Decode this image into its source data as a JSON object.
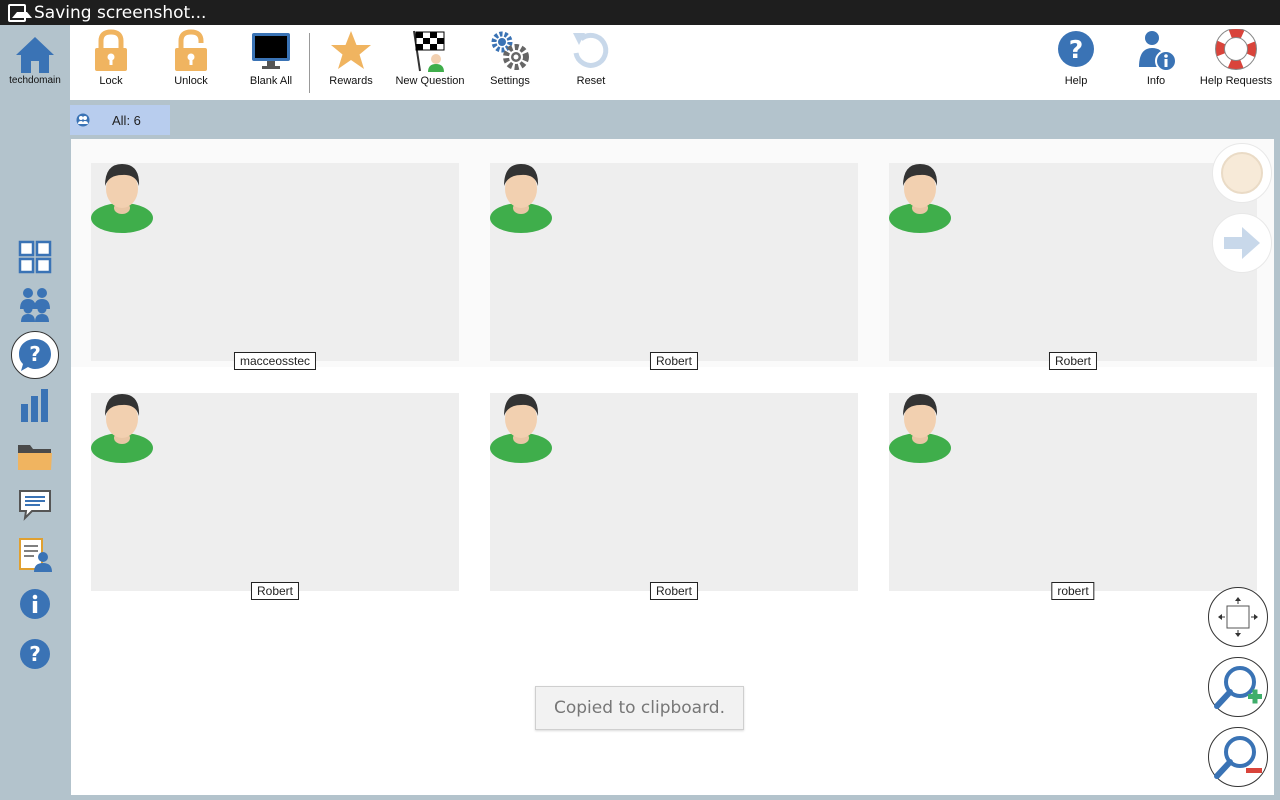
{
  "status_bar": {
    "text": "Saving screenshot..."
  },
  "sidebar": {
    "home_label": "techdomain",
    "items": [
      {
        "icon": "grid-view-icon"
      },
      {
        "icon": "groups-icon"
      },
      {
        "icon": "question-bubble-icon",
        "active": true
      },
      {
        "icon": "bar-chart-icon"
      },
      {
        "icon": "folder-icon"
      },
      {
        "icon": "chat-icon"
      },
      {
        "icon": "student-report-icon"
      },
      {
        "icon": "info-icon"
      },
      {
        "icon": "help-icon"
      }
    ]
  },
  "toolbar": {
    "lock": "Lock",
    "unlock": "Unlock",
    "blank_all": "Blank All",
    "rewards": "Rewards",
    "new_question": "New Question",
    "settings": "Settings",
    "reset": "Reset",
    "help": "Help",
    "info": "Info",
    "help_requests": "Help Requests"
  },
  "tabs": {
    "all_label": "All: 6"
  },
  "students": [
    {
      "name": "macceosstec"
    },
    {
      "name": "Robert"
    },
    {
      "name": "Robert"
    },
    {
      "name": "Robert"
    },
    {
      "name": "Robert"
    },
    {
      "name": "robert"
    }
  ],
  "toast": {
    "text": "Copied to clipboard."
  },
  "colors": {
    "accent_blue": "#3a73b5",
    "lock_orange": "#f0b460",
    "sidebar_bg": "#b3c3cc",
    "tab_bg": "#b8cdee",
    "zoom_in_green": "#3fae6b",
    "zoom_out_red": "#d9443b"
  }
}
